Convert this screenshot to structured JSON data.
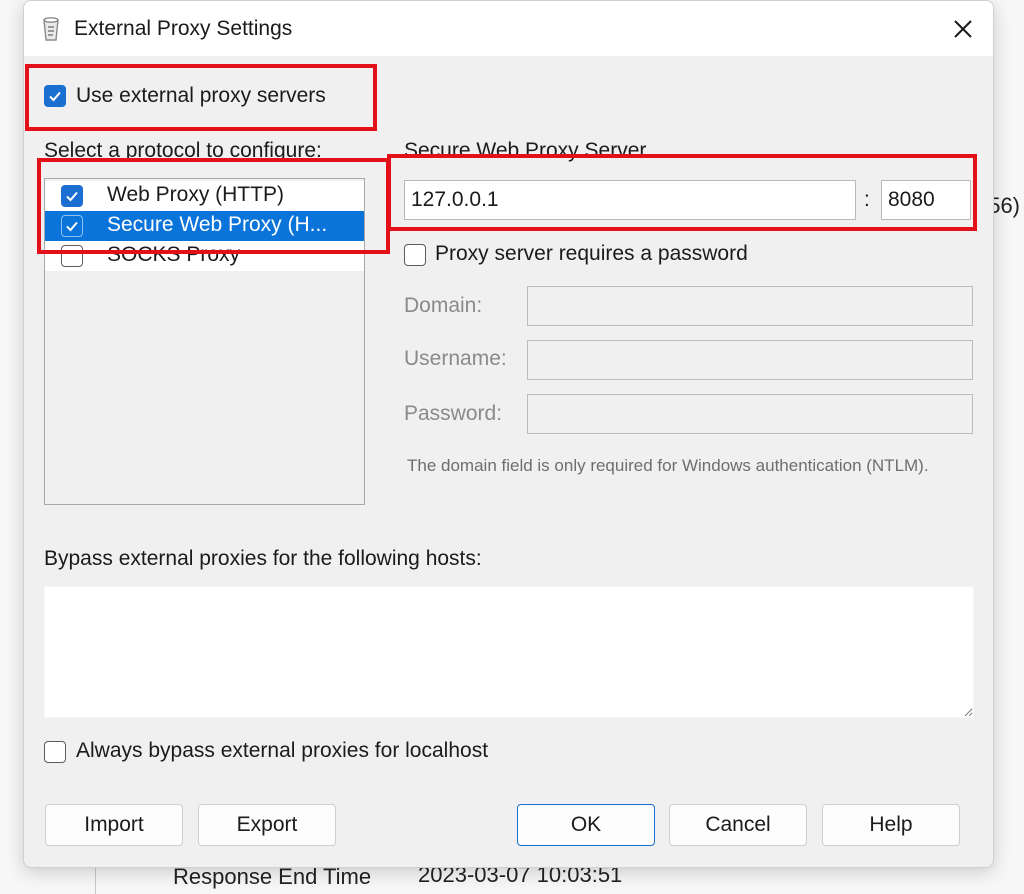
{
  "dialog": {
    "title": "External Proxy Settings",
    "close_icon": "close-icon"
  },
  "use_external": {
    "label": "Use external proxy servers",
    "checked": true
  },
  "protocols": {
    "heading": "Select a protocol to configure:",
    "items": [
      {
        "label": "Web Proxy (HTTP)",
        "checked": true,
        "selected": false
      },
      {
        "label": "Secure Web Proxy (H...",
        "checked": true,
        "selected": true
      },
      {
        "label": "SOCKS Proxy",
        "checked": false,
        "selected": false
      }
    ]
  },
  "server": {
    "heading": "Secure Web Proxy Server",
    "host": "127.0.0.1",
    "separator": ":",
    "port": "8080"
  },
  "auth": {
    "requires_password_label": "Proxy server requires a password",
    "requires_password_checked": false,
    "domain_label": "Domain:",
    "username_label": "Username:",
    "password_label": "Password:",
    "note": "The domain field is only required for Windows authentication (NTLM)."
  },
  "bypass": {
    "label": "Bypass external proxies for the following hosts:",
    "value": "",
    "localhost_label": "Always bypass external proxies for localhost",
    "localhost_checked": false
  },
  "buttons": {
    "import": "Import",
    "export": "Export",
    "ok": "OK",
    "cancel": "Cancel",
    "help": "Help"
  },
  "background": {
    "right_fragment": "56)",
    "row_label": "Response End Time",
    "row_value": "2023-03-07 10:03:51"
  },
  "colors": {
    "highlight": "#e3101a",
    "accent": "#1a6fd0",
    "selection": "#0a74da"
  }
}
